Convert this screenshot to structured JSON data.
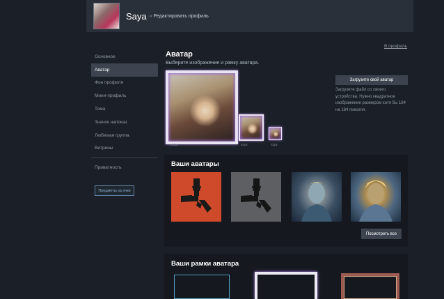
{
  "header": {
    "username": "Saya",
    "separator": "»",
    "page_title": "Редактировать профиль"
  },
  "sidebar": {
    "items": [
      {
        "label": "Основное"
      },
      {
        "label": "Аватар"
      },
      {
        "label": "Фон профиля"
      },
      {
        "label": "Мини-профиль"
      },
      {
        "label": "Тема"
      },
      {
        "label": "Значок напоказ"
      },
      {
        "label": "Любимая группа"
      },
      {
        "label": "Витрины"
      },
      {
        "label": "Приватность"
      }
    ],
    "active_index": 1,
    "points_button": "Предметы за очки"
  },
  "my_profile_link": "В профиль",
  "avatar_section": {
    "title": "Аватар",
    "subtitle": "Выберите изображение и рамку аватара.",
    "size_labels": [
      "184px",
      "64px",
      "32px"
    ],
    "upload_button": "Загрузите свой аватар",
    "upload_hint": "Загрузите файл со своего устройства. Нужно квадратное изображение размером хотя бы 184 на 184 пикселя."
  },
  "your_avatars": {
    "title": "Ваши аватары",
    "view_all": "Посмотреть все"
  },
  "your_frames": {
    "title": "Ваши рамки аватара"
  },
  "colors": {
    "background": "#1b2028",
    "panel": "#15191f",
    "active_item": "#3d4450",
    "frame_glow": "#9b6bd6"
  }
}
